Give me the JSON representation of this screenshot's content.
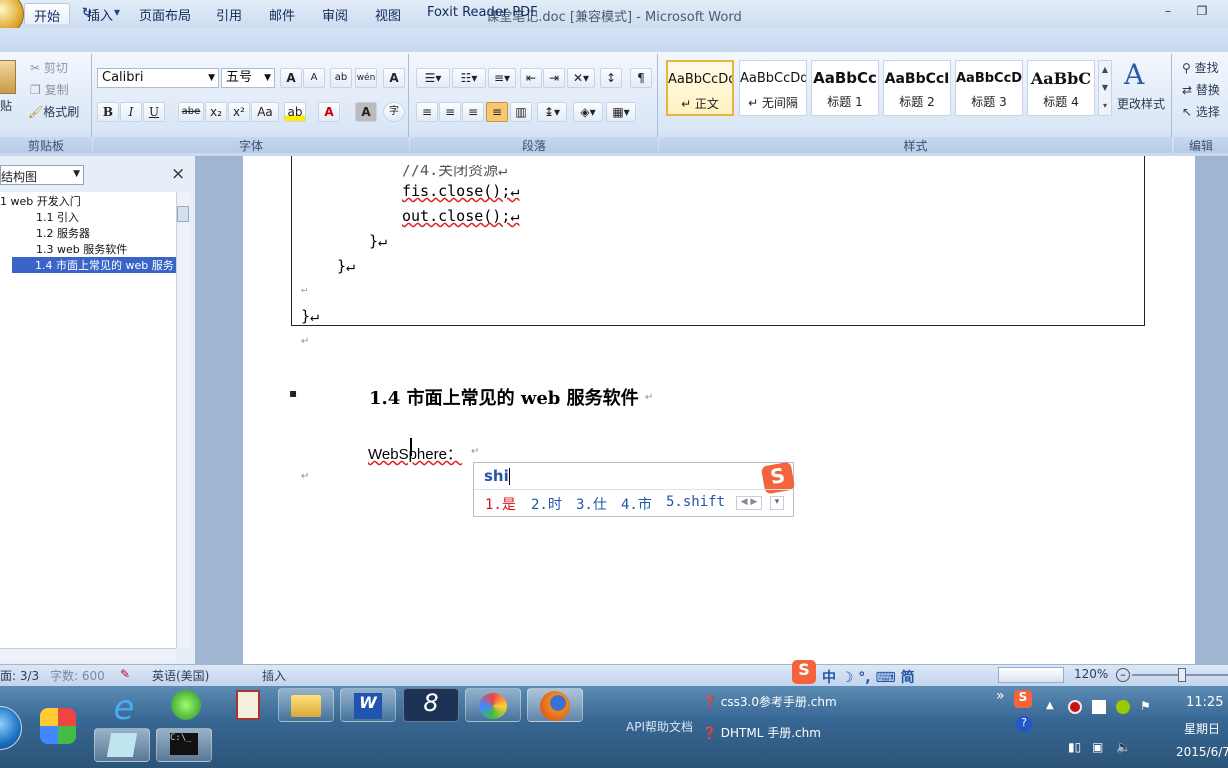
{
  "window": {
    "title": "课堂笔记.doc [兼容模式] - Microsoft Word",
    "minimize": "–",
    "restore": "❐"
  },
  "qat": {
    "save": "save-icon",
    "undo": "↶ ▾",
    "redo": "↻",
    "more": "▾"
  },
  "tabs": [
    "开始",
    "插入",
    "页面布局",
    "引用",
    "邮件",
    "审阅",
    "视图",
    "Foxit Reader PDF"
  ],
  "clipboard": {
    "paste": "贴",
    "cut": "剪切",
    "copy": "复制",
    "format_painter": "格式刷",
    "label": "剪贴板"
  },
  "font": {
    "name": "Calibri",
    "size": "五号",
    "label": "字体",
    "grow": "A",
    "shrink": "A",
    "clear": "ab",
    "phonetic": "wén",
    "border": "A",
    "bold": "B",
    "italic": "I",
    "underline": "U",
    "strike": "abe",
    "sub": "x₂",
    "sup": "x²",
    "case": "Aa",
    "highlight": "ab",
    "color": "A",
    "shade": "A",
    "enclose": "字"
  },
  "paragraph": {
    "label": "段落"
  },
  "styles": {
    "label": "样式",
    "change": "更改样式",
    "items": [
      {
        "sample": "AaBbCcDd",
        "name": "↵ 正文"
      },
      {
        "sample": "AaBbCcDd",
        "name": "↵ 无间隔"
      },
      {
        "sample": "AaBbCc",
        "name": "标题 1"
      },
      {
        "sample": "AaBbCcI",
        "name": "标题 2"
      },
      {
        "sample": "AaBbCcD",
        "name": "标题 3"
      },
      {
        "sample": "AaBbC",
        "name": "标题 4"
      }
    ]
  },
  "editing": {
    "find": "查找",
    "replace": "替换",
    "select": "选择",
    "label": "编辑"
  },
  "nav": {
    "mode": "结构图",
    "close": "×",
    "items": [
      "1 web 开发入门",
      "1.1 引入",
      "1.2 服务器",
      "1.3 web 服务软件",
      "1.4 市面上常见的 web 服务"
    ]
  },
  "doc": {
    "code": [
      "//4.关闭资源↵",
      "fis.close();↵",
      "out.close();↵",
      "}↵",
      "}↵",
      "↵",
      "}↵"
    ],
    "para": "↵",
    "heading_bullet": "▪",
    "heading": "1.4  市面上常见的 web 服务软件",
    "heading_mark": "↵",
    "body": "WebSphere：",
    "body_mark": "↵",
    "empty": "↵"
  },
  "ime": {
    "input": "shi",
    "logo": "S",
    "candidates": [
      "1.是",
      "2.时",
      "3.仕",
      "4.市",
      "5.shift"
    ]
  },
  "status": {
    "page": "面: 3/3",
    "words": "字数: 600",
    "lang": "英语(美国)",
    "mode": "插入",
    "zoom": "120%",
    "ime_bar": "中 ☽ °, ⌨ 简"
  },
  "taskbar": {
    "files": [
      "css3.0参考手册.chm",
      "DHTML 手册.chm"
    ],
    "api": "API帮助文档",
    "time": "11:25",
    "day": "星期日",
    "date": "2015/6/7",
    "more": "»"
  }
}
